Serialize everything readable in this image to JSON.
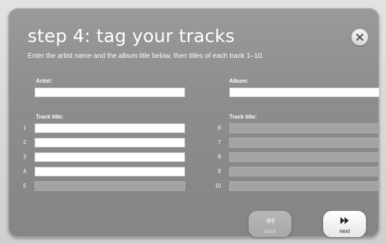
{
  "dialog": {
    "title": "step 4: tag your tracks",
    "subtitle": "Enter the artist name and the album title below, then titles of each track 1–10.",
    "close_icon": "close-icon"
  },
  "artist": {
    "label": "Artist:",
    "value": ""
  },
  "album": {
    "label": "Album:",
    "value": ""
  },
  "left_tracks": {
    "label": "Track title:",
    "rows": [
      {
        "number": "1",
        "value": "",
        "enabled": true
      },
      {
        "number": "2",
        "value": "",
        "enabled": true
      },
      {
        "number": "3",
        "value": "",
        "enabled": true
      },
      {
        "number": "4",
        "value": "",
        "enabled": true
      },
      {
        "number": "5",
        "value": "",
        "enabled": false
      }
    ]
  },
  "right_tracks": {
    "label": "Track title:",
    "rows": [
      {
        "number": "6",
        "value": "",
        "enabled": false
      },
      {
        "number": "7",
        "value": "",
        "enabled": false
      },
      {
        "number": "8",
        "value": "",
        "enabled": false
      },
      {
        "number": "9",
        "value": "",
        "enabled": false
      },
      {
        "number": "10",
        "value": "",
        "enabled": false
      }
    ]
  },
  "navigation": {
    "back_label": "back",
    "back_icon": "rewind-icon",
    "back_enabled": false,
    "next_label": "next",
    "next_icon": "fast-forward-icon",
    "next_enabled": true
  },
  "colors": {
    "dialog_background": "#8e8e8e",
    "text": "#ffffff",
    "input_enabled": "#ffffff",
    "input_disabled": "#a3a3a3"
  }
}
